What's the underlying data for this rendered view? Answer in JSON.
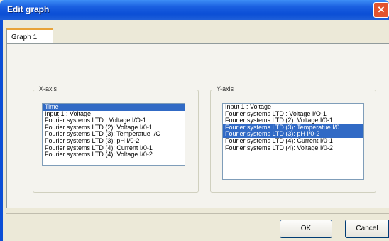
{
  "window": {
    "title": "Edit graph",
    "close_icon": "close-icon"
  },
  "tabs": [
    {
      "label": "Graph 1"
    }
  ],
  "x_axis": {
    "label": "X-axis",
    "items": [
      {
        "label": "Time",
        "selected": true
      },
      {
        "label": "Input 1 : Voltage",
        "selected": false
      },
      {
        "label": "Fourier systems LTD : Voltage I/O-1",
        "selected": false
      },
      {
        "label": "Fourier systems LTD (2): Voltage I/0-1",
        "selected": false
      },
      {
        "label": "Fourier systems LTD (3): Temperatue I/C",
        "selected": false
      },
      {
        "label": "Fourier systems LTD (3): pH I/0-2",
        "selected": false
      },
      {
        "label": "Fourier systems LTD (4): Current I/0-1",
        "selected": false
      },
      {
        "label": "Fourier systems LTD (4): Voltage I/0-2",
        "selected": false
      }
    ]
  },
  "y_axis": {
    "label": "Y-axis",
    "items": [
      {
        "label": "Input 1 : Voltage",
        "selected": false
      },
      {
        "label": "Fourier systems LTD : Voltage I/O-1",
        "selected": false
      },
      {
        "label": "Fourier systems LTD (2): Voltage I/0-1",
        "selected": false
      },
      {
        "label": "Fourier systems LTD (3): Temperatue I/0",
        "selected": true
      },
      {
        "label": "Fourier systems LTD (3): pH I/0-2",
        "selected": true
      },
      {
        "label": "Fourier systems LTD (4): Current I/0-1",
        "selected": false
      },
      {
        "label": "Fourier systems LTD (4): Voltage I/0-2",
        "selected": false
      }
    ]
  },
  "buttons": {
    "ok": "OK",
    "cancel": "Cancel"
  },
  "colors": {
    "title_bar": "#0b4ed6",
    "selection": "#316ac5",
    "dialog_bg": "#ece9d8"
  }
}
